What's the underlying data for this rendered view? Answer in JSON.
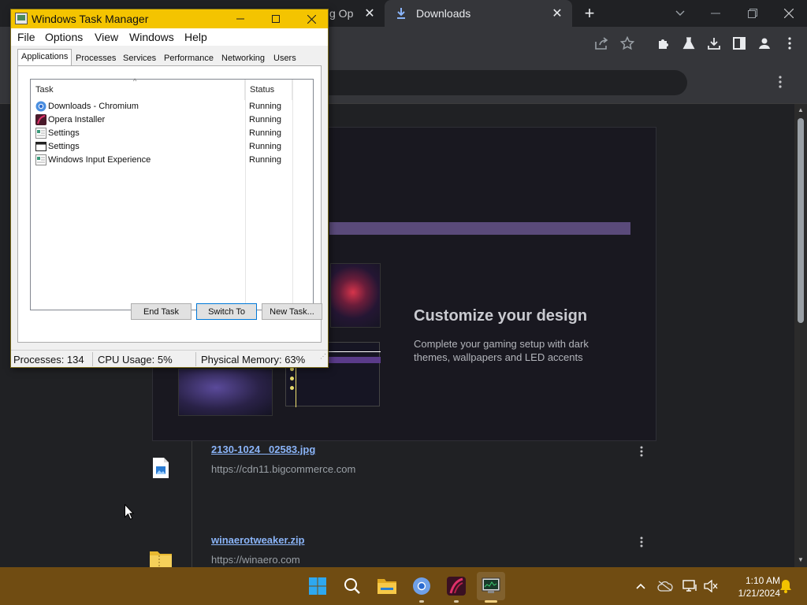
{
  "browser": {
    "inactive_tab_title": "g Opc",
    "active_tab_title": "Downloads",
    "tab_close_glyph": "✕",
    "new_tab_glyph": "+"
  },
  "downloads": {
    "promo": {
      "title": "Customize your design",
      "text": "Complete your gaming setup with dark themes, wallpapers and LED accents"
    },
    "items": [
      {
        "name": "2130-1024 _02583.jpg",
        "url": "https://cdn11.bigcommerce.com",
        "icon": "image-file-icon"
      },
      {
        "name": "winaerotweaker.zip",
        "url": "https://winaero.com",
        "icon": "zip-folder-icon"
      }
    ]
  },
  "task_manager": {
    "title": "Windows Task Manager",
    "menu": [
      "File",
      "Options",
      "View",
      "Windows",
      "Help"
    ],
    "tabs": [
      "Applications",
      "Processes",
      "Services",
      "Performance",
      "Networking",
      "Users"
    ],
    "selected_tab": "Applications",
    "columns": {
      "task": "Task",
      "status": "Status"
    },
    "rows": [
      {
        "task": "Downloads - Chromium",
        "status": "Running",
        "icon": "chromium-icon"
      },
      {
        "task": "Opera Installer",
        "status": "Running",
        "icon": "opera-icon"
      },
      {
        "task": "Settings",
        "status": "Running",
        "icon": "window-icon"
      },
      {
        "task": "Settings",
        "status": "Running",
        "icon": "window-frame-icon"
      },
      {
        "task": "Windows Input Experience",
        "status": "Running",
        "icon": "window-icon"
      }
    ],
    "buttons": {
      "end_task": "End Task",
      "switch_to": "Switch To",
      "new_task": "New Task..."
    },
    "status_bar": {
      "processes": "Processes: 134",
      "cpu": "CPU Usage: 5%",
      "memory": "Physical Memory: 63%"
    }
  },
  "taskbar": {
    "apps": [
      "windows-start-icon",
      "search-icon",
      "file-explorer-icon",
      "chromium-icon",
      "opera-icon",
      "task-manager-icon"
    ],
    "clock": {
      "time": "1:10 AM",
      "date": "1/21/2024"
    }
  },
  "colors": {
    "taskbar": "#704c12",
    "task_manager_title": "#f4c400",
    "link": "#8ab4f8"
  }
}
